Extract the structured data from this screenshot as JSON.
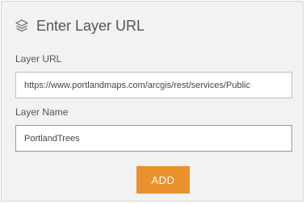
{
  "dialog": {
    "title": "Enter Layer URL",
    "icon": "layers-icon"
  },
  "layer_url": {
    "label": "Layer URL",
    "value": "https://www.portlandmaps.com/arcgis/rest/services/Public"
  },
  "layer_name": {
    "label": "Layer Name",
    "value": "PortlandTrees"
  },
  "actions": {
    "add_label": "ADD",
    "accent_color": "#e8912d"
  }
}
